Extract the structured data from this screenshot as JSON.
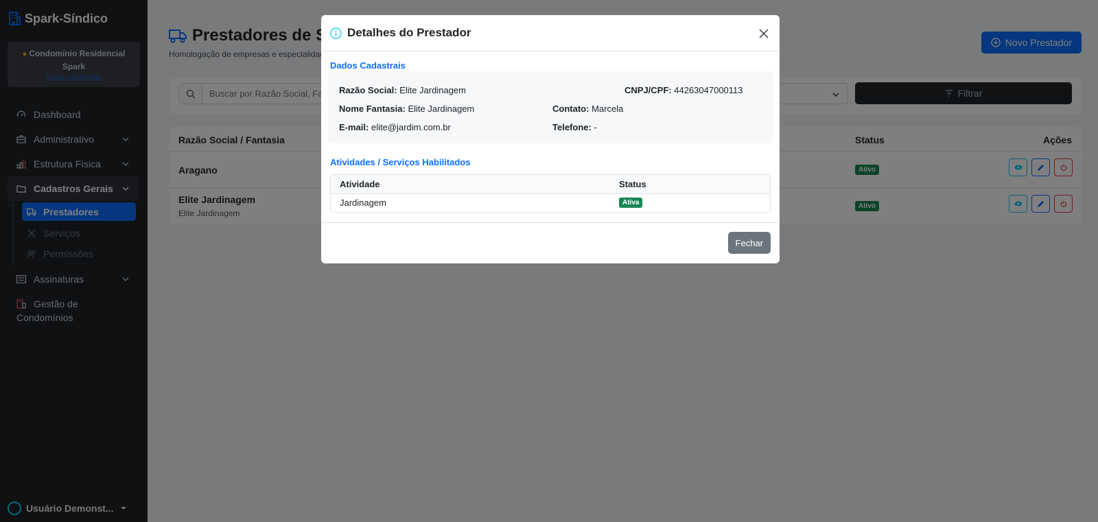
{
  "app": {
    "brand": "Spark-Síndico"
  },
  "sidebar": {
    "condo_name": "Condomínio Residencial Spark",
    "condo_switch": "Trocar condomínio",
    "items": [
      {
        "label": "Dashboard",
        "icon": "speedometer-icon"
      },
      {
        "label": "Administrativo",
        "icon": "briefcase-icon"
      },
      {
        "label": "Estrutura Física",
        "icon": "building-chart-icon"
      },
      {
        "label": "Cadastros Gerais",
        "icon": "folder-icon"
      }
    ],
    "subitems": [
      {
        "label": "Prestadores",
        "icon": "truck-icon"
      },
      {
        "label": "Serviços",
        "icon": "tools-icon"
      },
      {
        "label": "Permissões",
        "icon": "people-icon"
      }
    ],
    "items_after": [
      {
        "label": "Assinaturas",
        "icon": "card-list-icon"
      },
      {
        "label": "Gestão de Condomínios",
        "icon": "buildings-icon"
      }
    ],
    "user": "Usuário Demonst..."
  },
  "page": {
    "title": "Prestadores de Se",
    "subtitle": "Homologação de empresas e especialidade",
    "new_button": "Novo Prestador",
    "search_placeholder": "Buscar por Razão Social, Fan",
    "filter_button": "Filtrar",
    "columns": {
      "name": "Razão Social / Fantasia",
      "status": "Status",
      "actions": "Ações"
    },
    "rows": [
      {
        "name": "Aragano",
        "fantasia": "",
        "status": "Ativo"
      },
      {
        "name": "Elite Jardinagem",
        "fantasia": "Elite Jardinagem",
        "status": "Ativo"
      }
    ]
  },
  "modal": {
    "title": "Detalhes do Prestador",
    "section1": "Dados Cadastrais",
    "fields": {
      "razao_label": "Razão Social:",
      "razao": "Elite Jardinagem",
      "cnpj_label": "CNPJ/CPF:",
      "cnpj": "44263047000113",
      "fantasia_label": "Nome Fantasia:",
      "fantasia": "Elite Jardinagem",
      "contato_label": "Contato:",
      "contato": "Marcela",
      "email_label": "E-mail:",
      "email": "elite@jardim.com.br",
      "telefone_label": "Telefone:",
      "telefone": "-"
    },
    "section2": "Atividades / Serviços Habilitados",
    "activities_columns": {
      "activity": "Atividade",
      "status": "Status"
    },
    "activities": [
      {
        "activity": "Jardinagem",
        "status": "Ativa"
      }
    ],
    "close_button": "Fechar"
  },
  "colors": {
    "primary": "#0d6efd",
    "success": "#198754",
    "sidebar": "#1f2226",
    "secondary": "#6c757d"
  }
}
